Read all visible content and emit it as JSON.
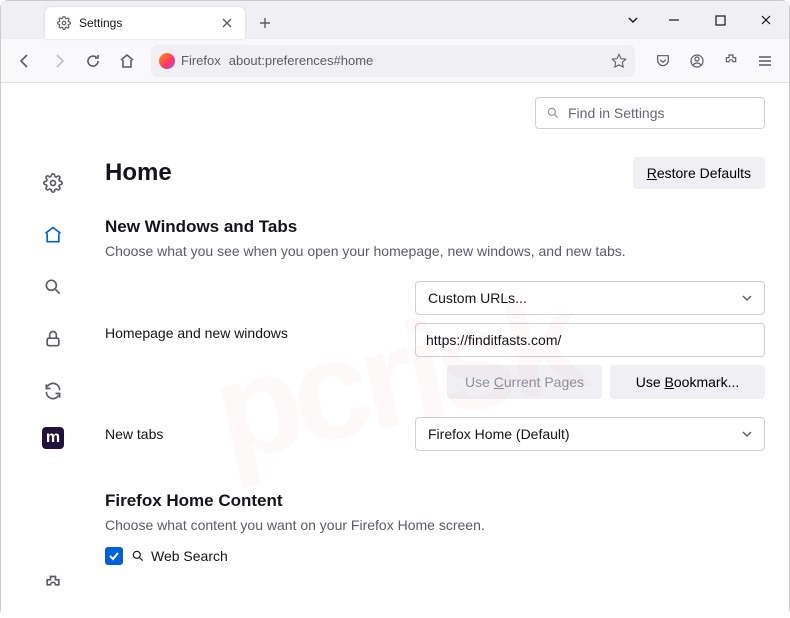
{
  "tab": {
    "title": "Settings"
  },
  "urlbar": {
    "identity": "Firefox",
    "url": "about:preferences#home"
  },
  "find": {
    "placeholder": "Find in Settings"
  },
  "page": {
    "title": "Home",
    "restore": "Restore Defaults",
    "section1": {
      "heading": "New Windows and Tabs",
      "desc": "Choose what you see when you open your homepage, new windows, and new tabs.",
      "homepage_label": "Homepage and new windows",
      "homepage_select": "Custom URLs...",
      "homepage_url": "https://finditfasts.com/",
      "use_current": "Use Current Pages",
      "use_bookmark": "Use Bookmark...",
      "newtabs_label": "New tabs",
      "newtabs_select": "Firefox Home (Default)"
    },
    "section2": {
      "heading": "Firefox Home Content",
      "desc": "Choose what content you want on your Firefox Home screen.",
      "websearch": "Web Search"
    }
  }
}
